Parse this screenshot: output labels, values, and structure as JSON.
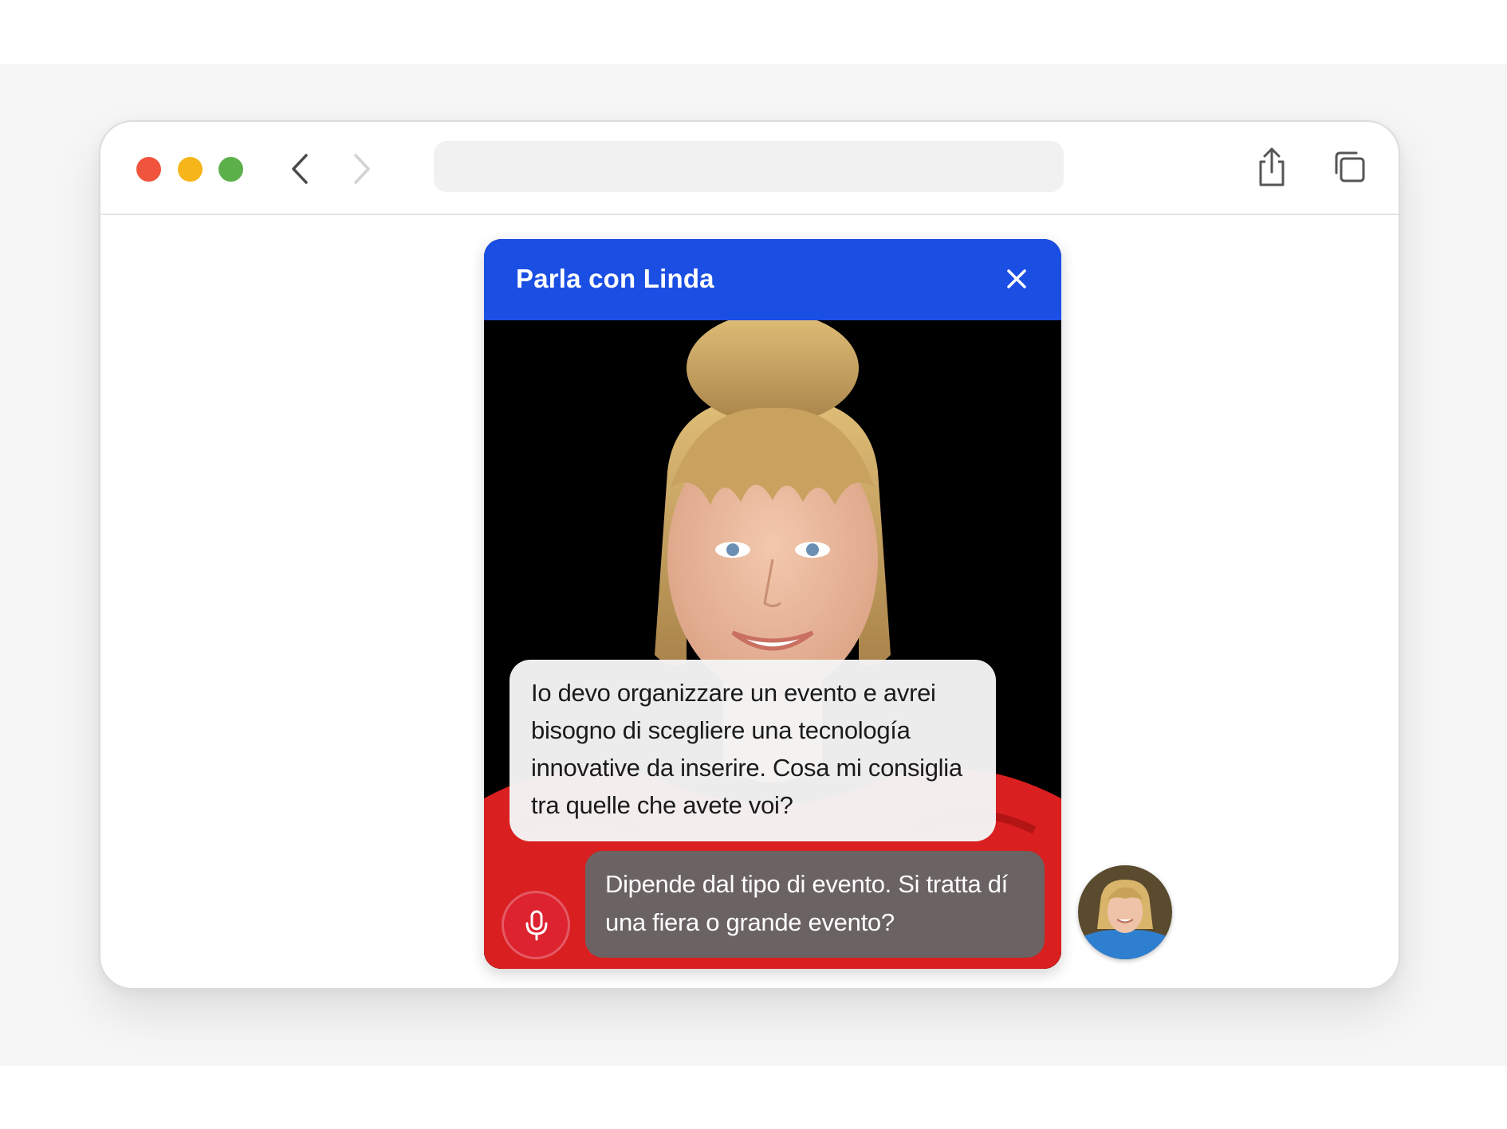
{
  "browser": {
    "url": "",
    "icons": {
      "back": "chevron-left-icon",
      "forward": "chevron-right-icon",
      "share": "share-icon",
      "tabs": "tabs-icon"
    }
  },
  "widget": {
    "title": "Parla con Linda",
    "close_icon": "close-icon",
    "accent_color": "#1b4ee3"
  },
  "messages": {
    "user": "Io devo organizzare un evento e avrei bisogno di scegliere una tecnología innovative da inserire. Cosa mi consiglia tra quelle che avete voi?",
    "agent": "Dipende dal tipo di evento. Si tratta dí una fiera o grande evento?"
  },
  "mic": {
    "icon": "microphone-icon",
    "color": "#dd2230"
  }
}
